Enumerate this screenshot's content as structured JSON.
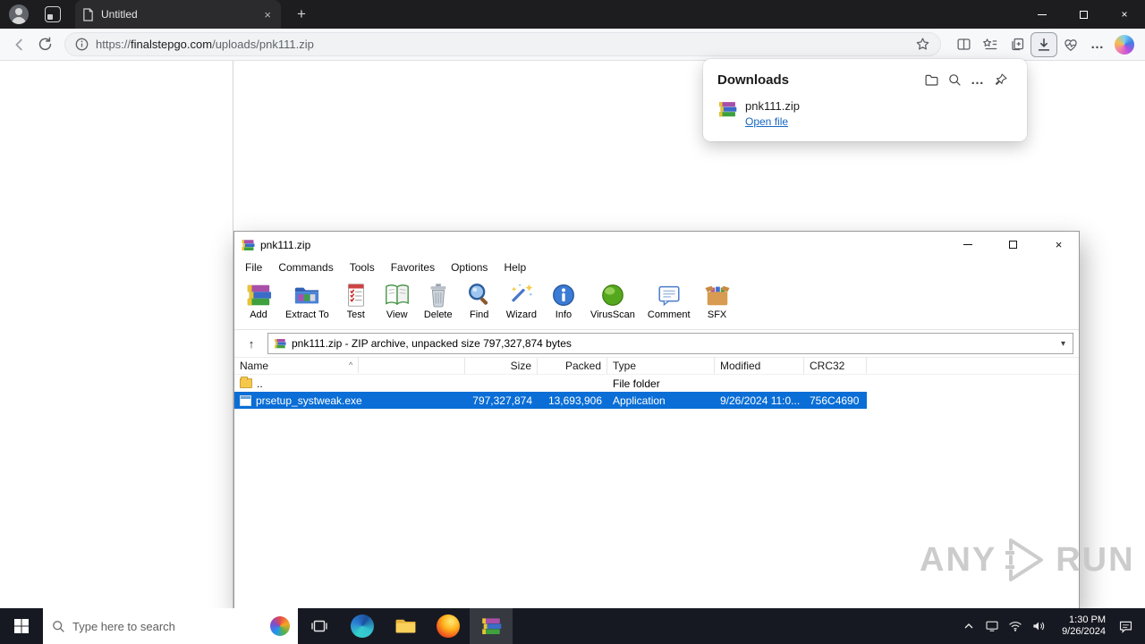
{
  "colors": {
    "selection_blue": "#0a6ed6",
    "link_blue": "#1766c2"
  },
  "glyphs": {
    "close": "×",
    "minimize": "–",
    "new_tab": "+",
    "up_arrow": "↑",
    "dropdown": "▾",
    "sort_asc": "^",
    "ellipsis_h": "…"
  },
  "browser": {
    "tab_title": "Untitled",
    "url_scheme": "https://",
    "url_host": "finalstepgo.com",
    "url_path": "/uploads/pnk111.zip",
    "downloads": {
      "title": "Downloads",
      "item_name": "pnk111.zip",
      "item_action": "Open file"
    }
  },
  "winrar": {
    "title": "pnk111.zip",
    "menus": [
      "File",
      "Commands",
      "Tools",
      "Favorites",
      "Options",
      "Help"
    ],
    "toolbar": [
      "Add",
      "Extract To",
      "Test",
      "View",
      "Delete",
      "Find",
      "Wizard",
      "Info",
      "VirusScan",
      "Comment",
      "SFX"
    ],
    "address": "pnk111.zip - ZIP archive, unpacked size 797,327,874 bytes",
    "columns": [
      "Name",
      "Size",
      "Packed",
      "Type",
      "Modified",
      "CRC32"
    ],
    "rows": [
      {
        "name": "..",
        "size": "",
        "packed": "",
        "type": "File folder",
        "modified": "",
        "crc32": ""
      },
      {
        "name": "prsetup_systweak.exe",
        "size": "797,327,874",
        "packed": "13,693,906",
        "type": "Application",
        "modified": "9/26/2024 11:0...",
        "crc32": "756C4690"
      }
    ]
  },
  "taskbar": {
    "search_placeholder": "Type here to search",
    "time": "1:30 PM",
    "date": "9/26/2024"
  },
  "watermark": {
    "left": "ANY",
    "right": "RUN"
  }
}
